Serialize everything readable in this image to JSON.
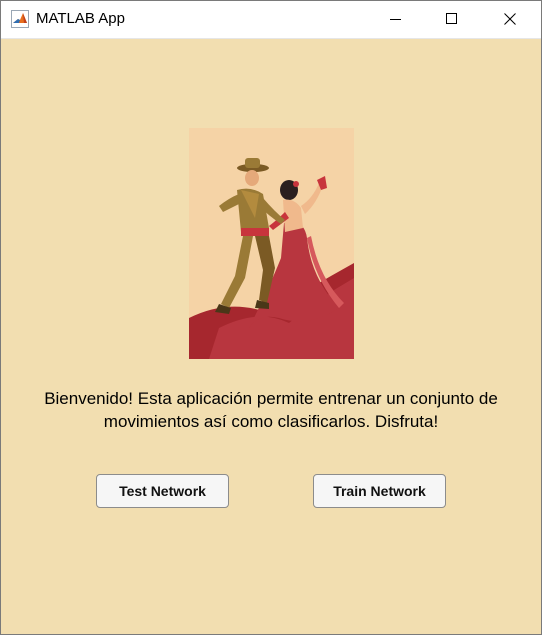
{
  "window": {
    "title": "MATLAB App"
  },
  "content": {
    "welcome_text": "Bienvenido! Esta aplicación permite entrenar un conjunto de movimientos así como clasificarlos. Disfruta!",
    "illustration_icon": "flamenco-dancers-illustration"
  },
  "buttons": {
    "test_label": "Test Network",
    "train_label": "Train Network"
  },
  "colors": {
    "background": "#f2deb0",
    "illustration_bg": "#f5d3a6",
    "dress_red": "#b8363f",
    "floor_red": "#a6272e",
    "suit_olive": "#9a7a36"
  }
}
